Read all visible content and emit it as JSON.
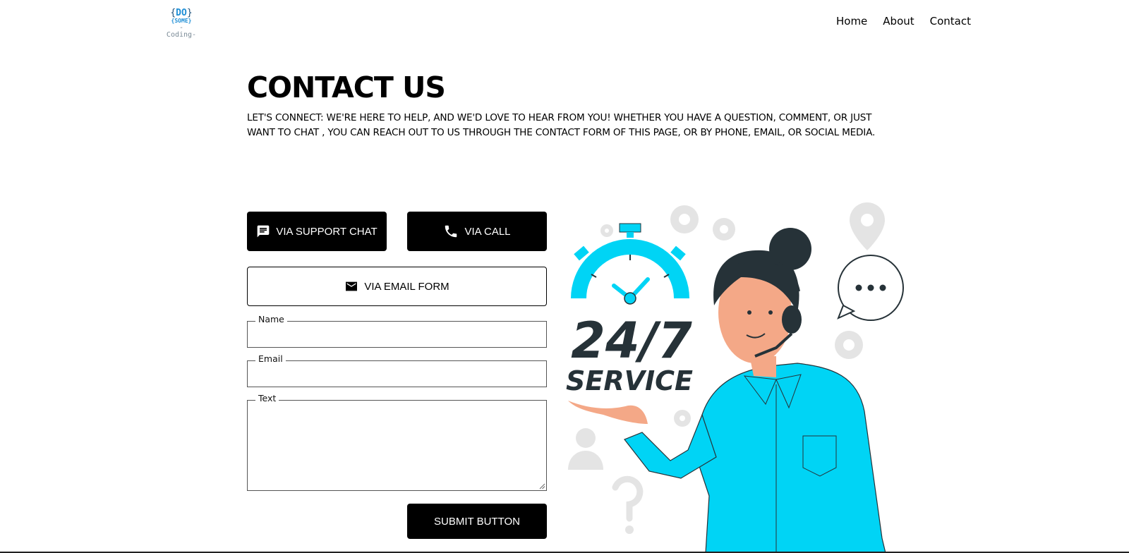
{
  "header": {
    "logo": {
      "line1_open": "{",
      "line1": "DO",
      "line1_close": "}",
      "line2": "{SOME}",
      "line3": "-Coding-"
    },
    "nav": [
      "Home",
      "About",
      "Contact"
    ]
  },
  "main": {
    "title": "CONTACT US",
    "intro": "LET'S CONNECT: WE'RE HERE TO HELP, AND WE'D LOVE TO HEAR FROM YOU! WHETHER YOU HAVE A QUESTION, COMMENT, OR JUST WANT TO CHAT , YOU CAN REACH OUT TO US THROUGH THE CONTACT FORM OF THIS PAGE, OR BY PHONE, EMAIL, OR SOCIAL MEDIA."
  },
  "buttons": {
    "support_chat": {
      "label": "VIA SUPPORT CHAT",
      "icon": "chat-icon"
    },
    "call": {
      "label": "VIA CALL",
      "icon": "phone-icon"
    },
    "email_form": {
      "label": "VIA EMAIL FORM",
      "icon": "envelope-icon"
    },
    "submit": {
      "label": "SUBMIT BUTTON"
    }
  },
  "form": {
    "name": {
      "label": "Name",
      "value": ""
    },
    "email": {
      "label": "Email",
      "value": ""
    },
    "text": {
      "label": "Text",
      "value": ""
    }
  },
  "illustration": {
    "big_text": "24/7",
    "sub_text": "SERVICE",
    "accent_color": "#00d4f5",
    "dark_color": "#263238"
  }
}
